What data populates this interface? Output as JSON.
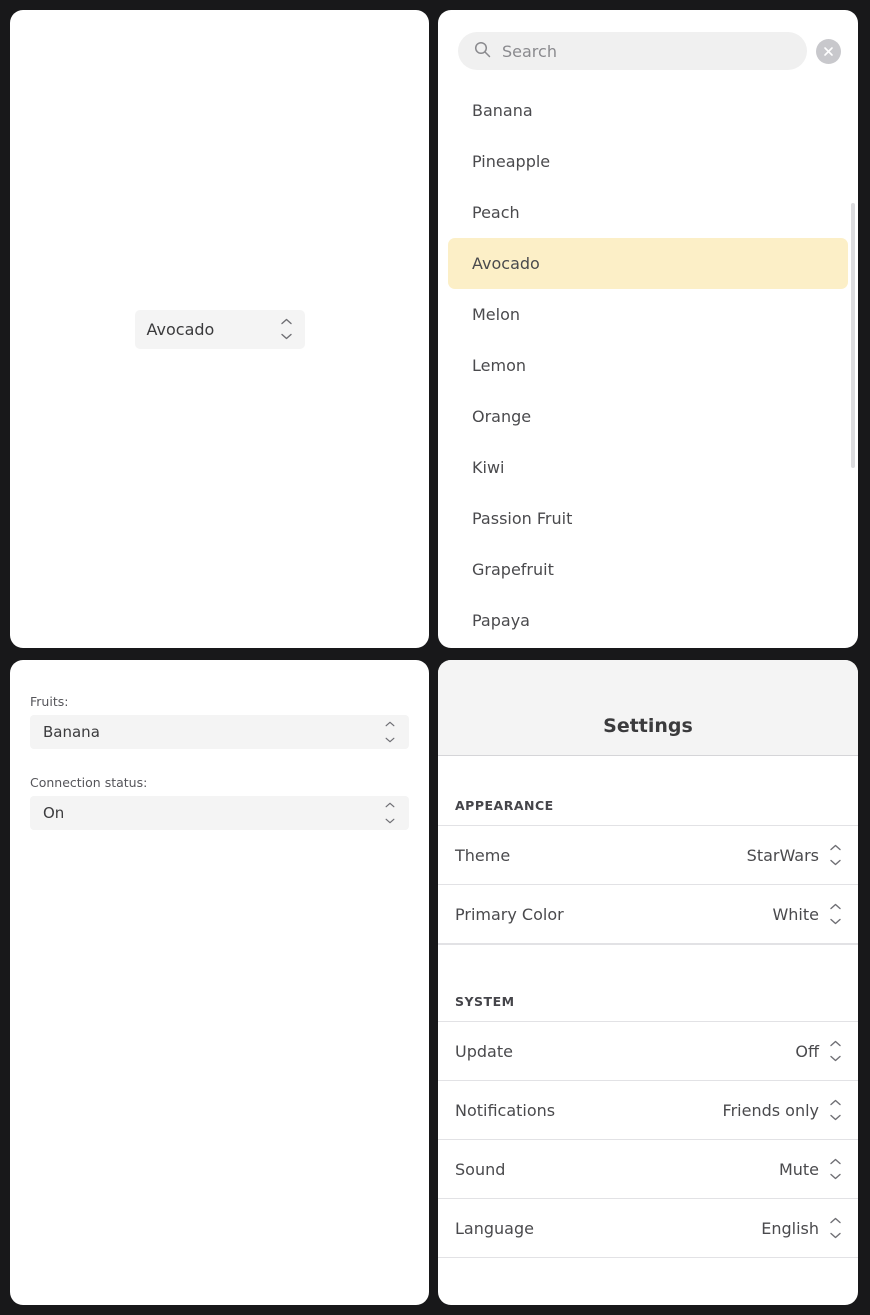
{
  "theme": {
    "background": "#18181a",
    "card": "#ffffff",
    "control_bg": "#f4f4f4",
    "highlight": "#fcefc7",
    "text": "#4a4a4d",
    "muted": "#8a8a8e"
  },
  "panel_top_left": {
    "name": "basic-select-panel",
    "select": {
      "value": "Avocado",
      "stepper_icon": "chevron-up-down-icon"
    }
  },
  "panel_top_right": {
    "name": "searchable-list-panel",
    "search": {
      "icon": "search-icon",
      "placeholder": "Search",
      "value": "",
      "clear_icon": "close-circle-icon"
    },
    "items": [
      {
        "label": "Banana",
        "selected": false
      },
      {
        "label": "Pineapple",
        "selected": false
      },
      {
        "label": "Peach",
        "selected": false
      },
      {
        "label": "Avocado",
        "selected": true
      },
      {
        "label": "Melon",
        "selected": false
      },
      {
        "label": "Lemon",
        "selected": false
      },
      {
        "label": "Orange",
        "selected": false
      },
      {
        "label": "Kiwi",
        "selected": false
      },
      {
        "label": "Passion Fruit",
        "selected": false
      },
      {
        "label": "Grapefruit",
        "selected": false
      },
      {
        "label": "Papaya",
        "selected": false
      }
    ],
    "scrollbar": "vertical-scrollbar"
  },
  "panel_bottom_left": {
    "name": "labelled-selects-panel",
    "fields": [
      {
        "label": "Fruits:",
        "value": "Banana",
        "stepper_icon": "chevron-up-down-icon"
      },
      {
        "label": "Connection status:",
        "value": "On",
        "stepper_icon": "chevron-up-down-icon"
      }
    ]
  },
  "panel_bottom_right": {
    "name": "settings-panel",
    "title": "Settings",
    "sections": [
      {
        "heading": "APPEARANCE",
        "rows": [
          {
            "label": "Theme",
            "value": "StarWars",
            "stepper_icon": "chevron-up-down-icon"
          },
          {
            "label": "Primary Color",
            "value": "White",
            "stepper_icon": "chevron-up-down-icon"
          }
        ]
      },
      {
        "heading": "SYSTEM",
        "rows": [
          {
            "label": "Update",
            "value": "Off",
            "stepper_icon": "chevron-up-down-icon"
          },
          {
            "label": "Notifications",
            "value": "Friends only",
            "stepper_icon": "chevron-up-down-icon"
          },
          {
            "label": "Sound",
            "value": "Mute",
            "stepper_icon": "chevron-up-down-icon"
          },
          {
            "label": "Language",
            "value": "English",
            "stepper_icon": "chevron-up-down-icon"
          }
        ]
      }
    ]
  }
}
